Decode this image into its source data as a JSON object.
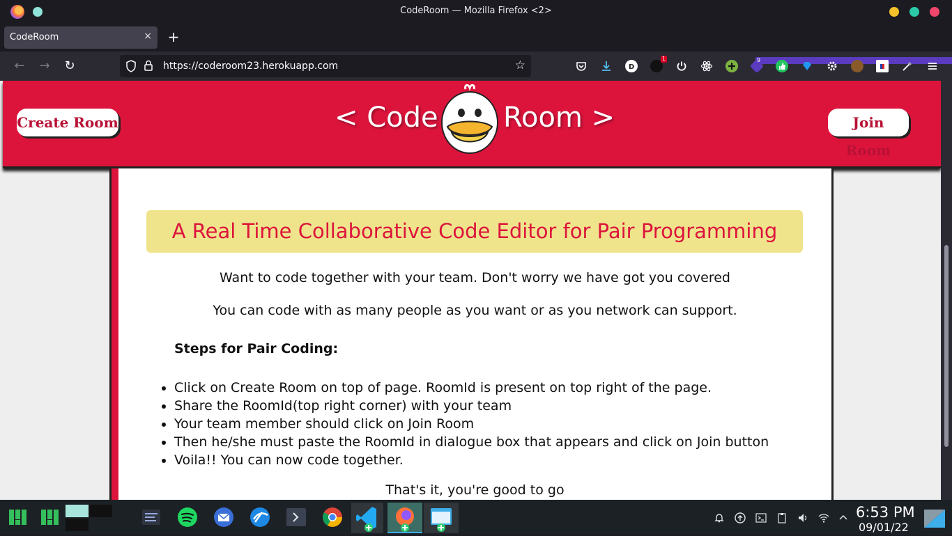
{
  "window": {
    "title": "CodeRoom — Mozilla Firefox <2>"
  },
  "tab": {
    "label": "CodeRoom",
    "close": "×",
    "new_tab": "+"
  },
  "nav": {
    "back": "←",
    "forward": "→",
    "reload": "↻",
    "url": "https://coderoom23.herokuapp.com",
    "bookmark": "☆"
  },
  "extensions": {
    "badge_1": "1",
    "badge_9": "9"
  },
  "header": {
    "create_button": "Create Room",
    "join_button": "Join Room",
    "logo_left": "< Code",
    "logo_right": "Room >"
  },
  "content": {
    "headline": "A Real Time Collaborative Code Editor for Pair Programming",
    "intro_1": "Want to code together with your team. Don't worry we have got you covered",
    "intro_2": "You can code with as many people as you want or as you network can support.",
    "steps_title": "Steps for Pair Coding:",
    "steps": [
      "Click on Create Room on top of page. RoomId is present on top right of the page.",
      "Share the RoomId(top right corner) with your team",
      "Your team member should click on Join Room",
      "Then he/she must paste the RoomId in dialogue box that appears and click on Join button",
      "Voila!! You can now code together."
    ],
    "outro": "That's it, you're good to go"
  },
  "taskbar": {
    "time": "6:53 PM",
    "date": "09/01/22"
  },
  "colors": {
    "brand_red": "#dc143c",
    "headline_bg": "#efe48c"
  }
}
